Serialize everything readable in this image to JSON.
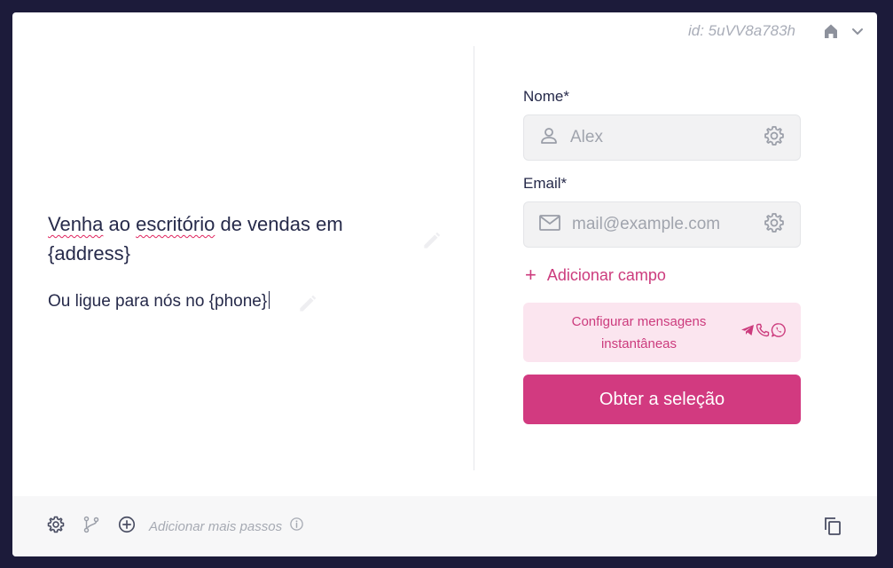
{
  "header": {
    "block_id": "id: 5uVV8a783h",
    "icons": [
      "home-icon",
      "chevron-down-icon"
    ]
  },
  "content": {
    "headline_part1": "Venha",
    "headline_part2": " ao ",
    "headline_part3": "escritório",
    "headline_part4": " de vendas em {address}",
    "subline": "Ou ligue para nós no {phone}"
  },
  "form": {
    "name_label": "Nome*",
    "name_placeholder": "Alex",
    "email_label": "Email*",
    "email_placeholder": "mail@example.com",
    "add_field": "Adicionar campo",
    "im_config": "Configurar mensagens instantâneas",
    "im_icons": [
      "telegram-icon",
      "phone-icon",
      "whatsapp-icon"
    ],
    "submit": "Obter a seleção"
  },
  "footer": {
    "add_steps": "Adicionar mais passos",
    "icons": [
      "gear-icon",
      "branch-icon",
      "add-circle-icon",
      "info-icon",
      "copy-icon"
    ]
  },
  "colors": {
    "background": "#1c1b3a",
    "accent": "#d23a80",
    "accent_light": "#fbe5ef",
    "text": "#262a4a",
    "muted": "#a9adb8"
  }
}
